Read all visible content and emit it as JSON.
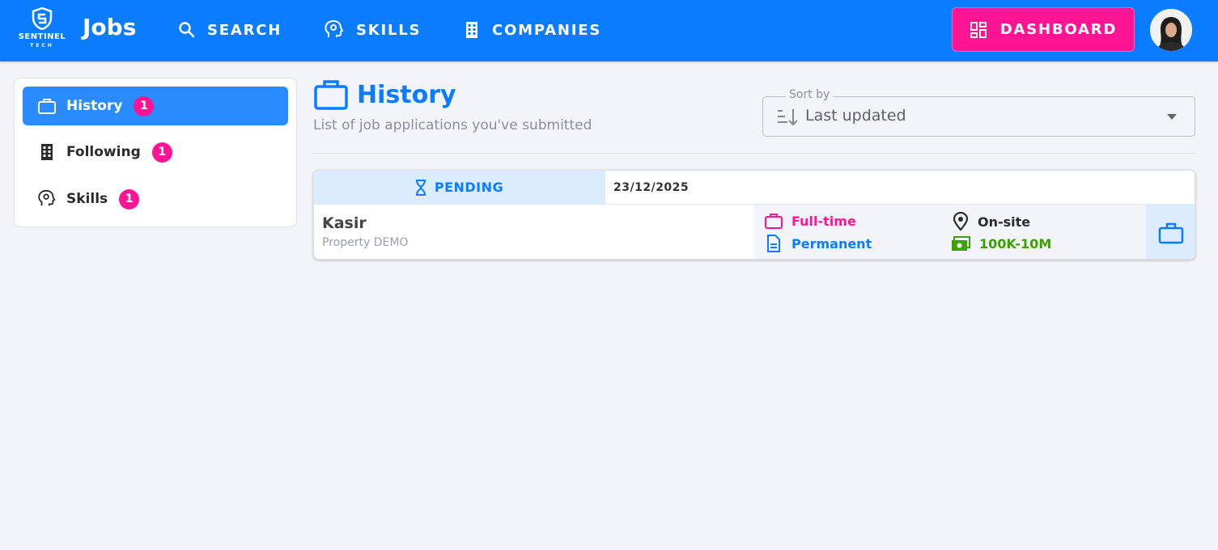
{
  "header": {
    "logo": {
      "line1": "SENTINEL",
      "line2": "TECH"
    },
    "brand": "Jobs",
    "nav": [
      {
        "label": "SEARCH",
        "icon": "search-icon"
      },
      {
        "label": "SKILLS",
        "icon": "head-brain-icon"
      },
      {
        "label": "COMPANIES",
        "icon": "building-icon"
      }
    ],
    "dashboard_label": "DASHBOARD",
    "colors": {
      "primary": "#0a7cff",
      "accent": "#ff1493"
    }
  },
  "sidebar": {
    "items": [
      {
        "label": "History",
        "count": "1",
        "icon": "briefcase-icon",
        "active": true
      },
      {
        "label": "Following",
        "count": "1",
        "icon": "building-icon",
        "active": false
      },
      {
        "label": "Skills",
        "count": "1",
        "icon": "head-brain-icon",
        "active": false
      }
    ]
  },
  "page": {
    "title": "History",
    "subtitle": "List of job applications you've submitted",
    "sort": {
      "legend": "Sort by",
      "value": "Last updated"
    }
  },
  "applications": [
    {
      "status": "PENDING",
      "date": "23/12/2025",
      "title": "Kasir",
      "company": "Property DEMO",
      "employment_type": "Full-time",
      "contract": "Permanent",
      "work_mode": "On-site",
      "salary": "100K-10M"
    }
  ]
}
